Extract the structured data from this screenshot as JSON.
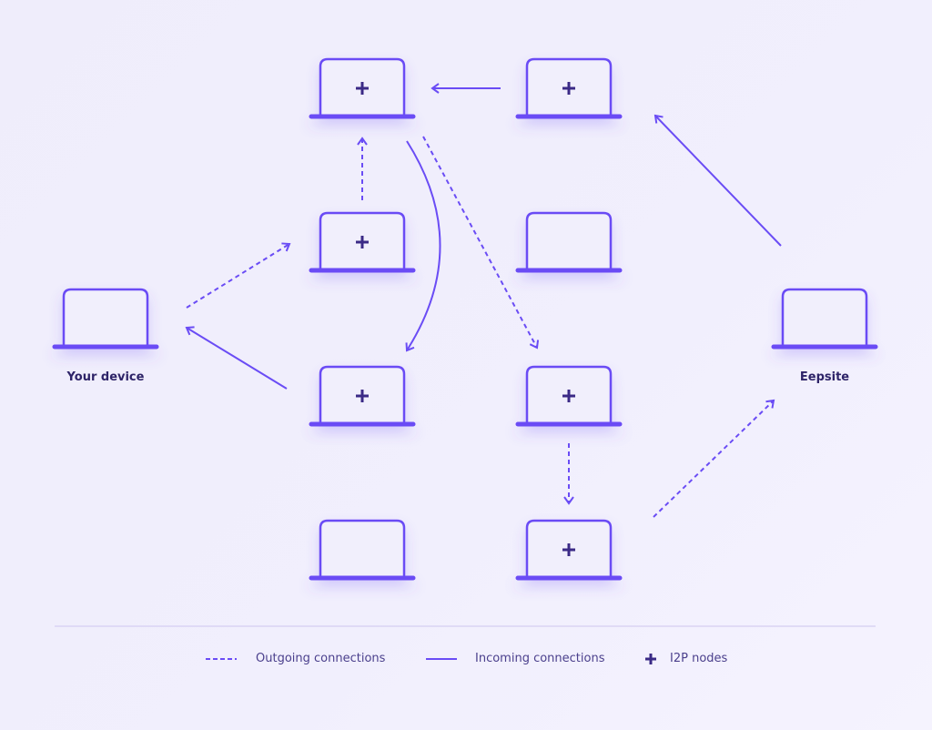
{
  "colors": {
    "stroke": "#6a4cf5",
    "plus": "#3a2a86",
    "label": "#2e2468",
    "divider": "#d9d4f3"
  },
  "nodes": [
    {
      "id": "n1",
      "i2p": true
    },
    {
      "id": "n2",
      "i2p": true
    },
    {
      "id": "n3",
      "i2p": true
    },
    {
      "id": "n4",
      "i2p": false
    },
    {
      "id": "n5",
      "i2p": true
    },
    {
      "id": "n6",
      "i2p": true
    },
    {
      "id": "n7",
      "i2p": false
    },
    {
      "id": "n8",
      "i2p": true
    },
    {
      "id": "device",
      "i2p": false,
      "label": "Your device"
    },
    {
      "id": "eepsite",
      "i2p": false,
      "label": "Eepsite"
    }
  ],
  "connections": [
    {
      "from": "n2",
      "to": "n1",
      "type": "incoming"
    },
    {
      "from": "n3",
      "to": "n1",
      "type": "outgoing"
    },
    {
      "from": "n1",
      "to": "n5",
      "type": "incoming"
    },
    {
      "from": "n1",
      "to": "n6",
      "type": "outgoing"
    },
    {
      "from": "eepsite",
      "to": "n2",
      "type": "incoming"
    },
    {
      "from": "device",
      "to": "n3",
      "type": "outgoing"
    },
    {
      "from": "n5",
      "to": "device",
      "type": "incoming"
    },
    {
      "from": "n6",
      "to": "n8",
      "type": "outgoing"
    },
    {
      "from": "n8",
      "to": "eepsite",
      "type": "outgoing"
    }
  ],
  "labels": {
    "device": "Your device",
    "eepsite": "Eepsite"
  },
  "legend": {
    "outgoing": "Outgoing connections",
    "incoming": "Incoming connections",
    "nodes": "I2P nodes"
  }
}
